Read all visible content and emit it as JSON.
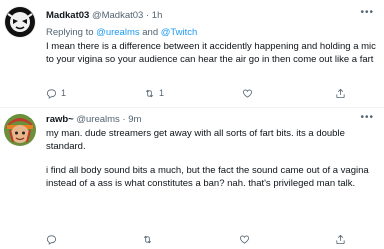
{
  "tweets": [
    {
      "display_name": "Madkat03",
      "handle": "@Madkat03",
      "sep": "·",
      "time": "1h",
      "replying_prefix": "Replying to",
      "mention_1": "@urealms",
      "and": "and",
      "mention_2": "@Twitch",
      "text": "I mean there is a  difference between it accidently happening and holding a mic to your vigina so your audience can hear the air go in then come out like a fart",
      "reply_count": "1",
      "retweet_count": "1",
      "like_count": ""
    },
    {
      "display_name": "rawb~",
      "handle": "@urealms",
      "sep": "·",
      "time": "9m",
      "paragraphs": [
        "my man. dude streamers get away with all sorts of fart bits. its a double standard.",
        "i find all body sound bits a much, but the fact the sound came out of a vagina instead of a ass is what constitutes a ban? nah. that's privileged man talk."
      ]
    }
  ],
  "icons": {
    "reply": "reply-icon",
    "retweet": "retweet-icon",
    "like": "heart-icon",
    "share": "share-icon",
    "more": "more-icon"
  },
  "colors": {
    "text": "#0f1419",
    "muted": "#536471",
    "link": "#1d9bf0",
    "divider": "#eff3f4"
  }
}
